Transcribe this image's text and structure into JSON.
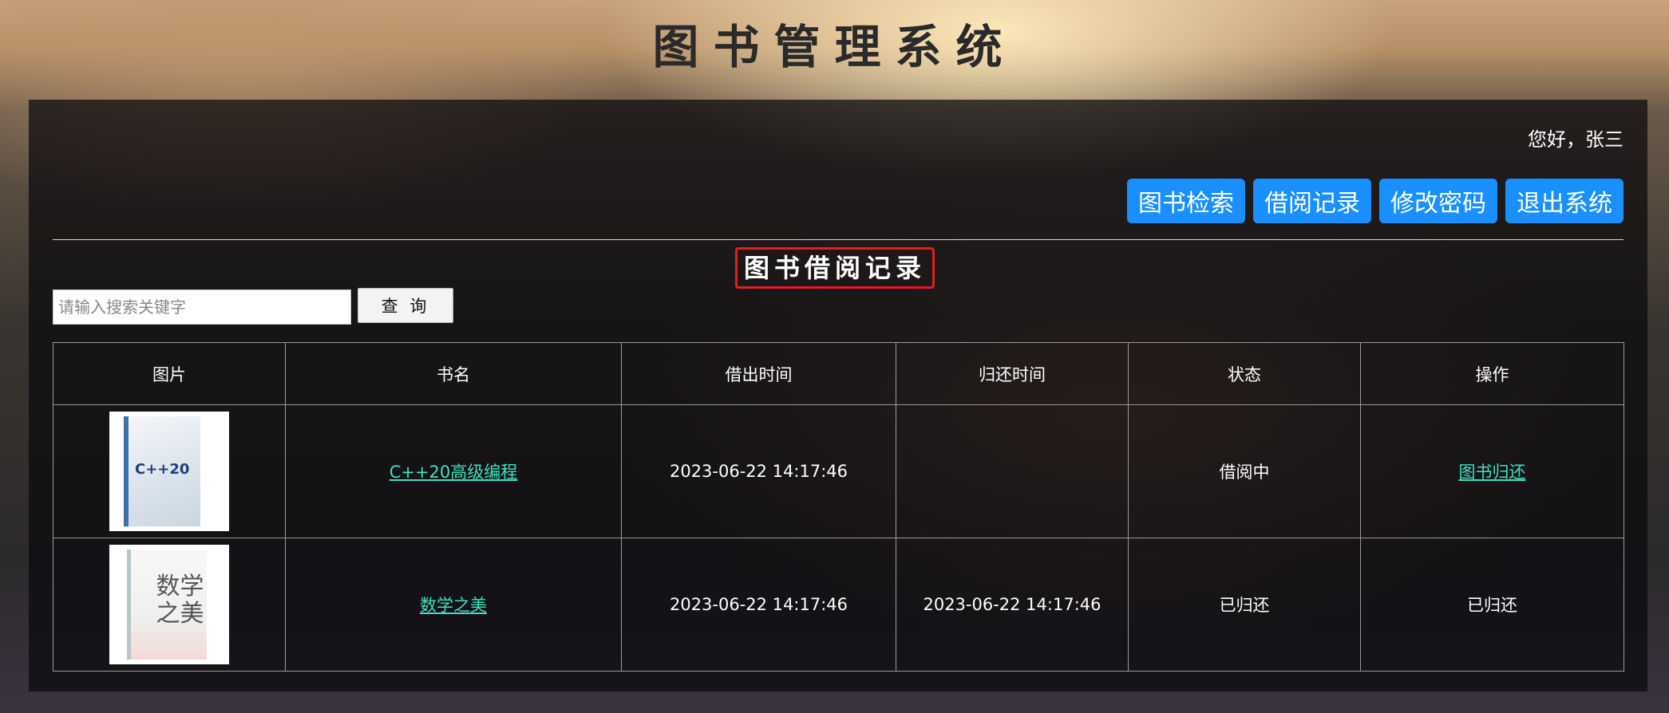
{
  "app": {
    "title": "图书管理系统"
  },
  "header": {
    "greeting": "您好，张三",
    "nav": [
      {
        "label": "图书检索"
      },
      {
        "label": "借阅记录"
      },
      {
        "label": "修改密码"
      },
      {
        "label": "退出系统"
      }
    ]
  },
  "section": {
    "title": "图书借阅记录"
  },
  "search": {
    "placeholder": "请输入搜索关键字",
    "value": "",
    "button_label": "查 询"
  },
  "table": {
    "columns": [
      "图片",
      "书名",
      "借出时间",
      "归还时间",
      "状态",
      "操作"
    ],
    "rows": [
      {
        "cover_text": "C++20",
        "name": "C++20高级编程",
        "borrowed_at": "2023-06-22 14:17:46",
        "returned_at": "",
        "status": "借阅中",
        "action": "图书归还"
      },
      {
        "cover_text": "数学之美",
        "name": "数学之美",
        "borrowed_at": "2023-06-22 14:17:46",
        "returned_at": "2023-06-22 14:17:46",
        "status": "已归还",
        "action": "已归还"
      }
    ]
  },
  "colors": {
    "nav_button": "#1a8fff",
    "link": "#3fe0c0",
    "highlight_border": "#e0211b"
  }
}
